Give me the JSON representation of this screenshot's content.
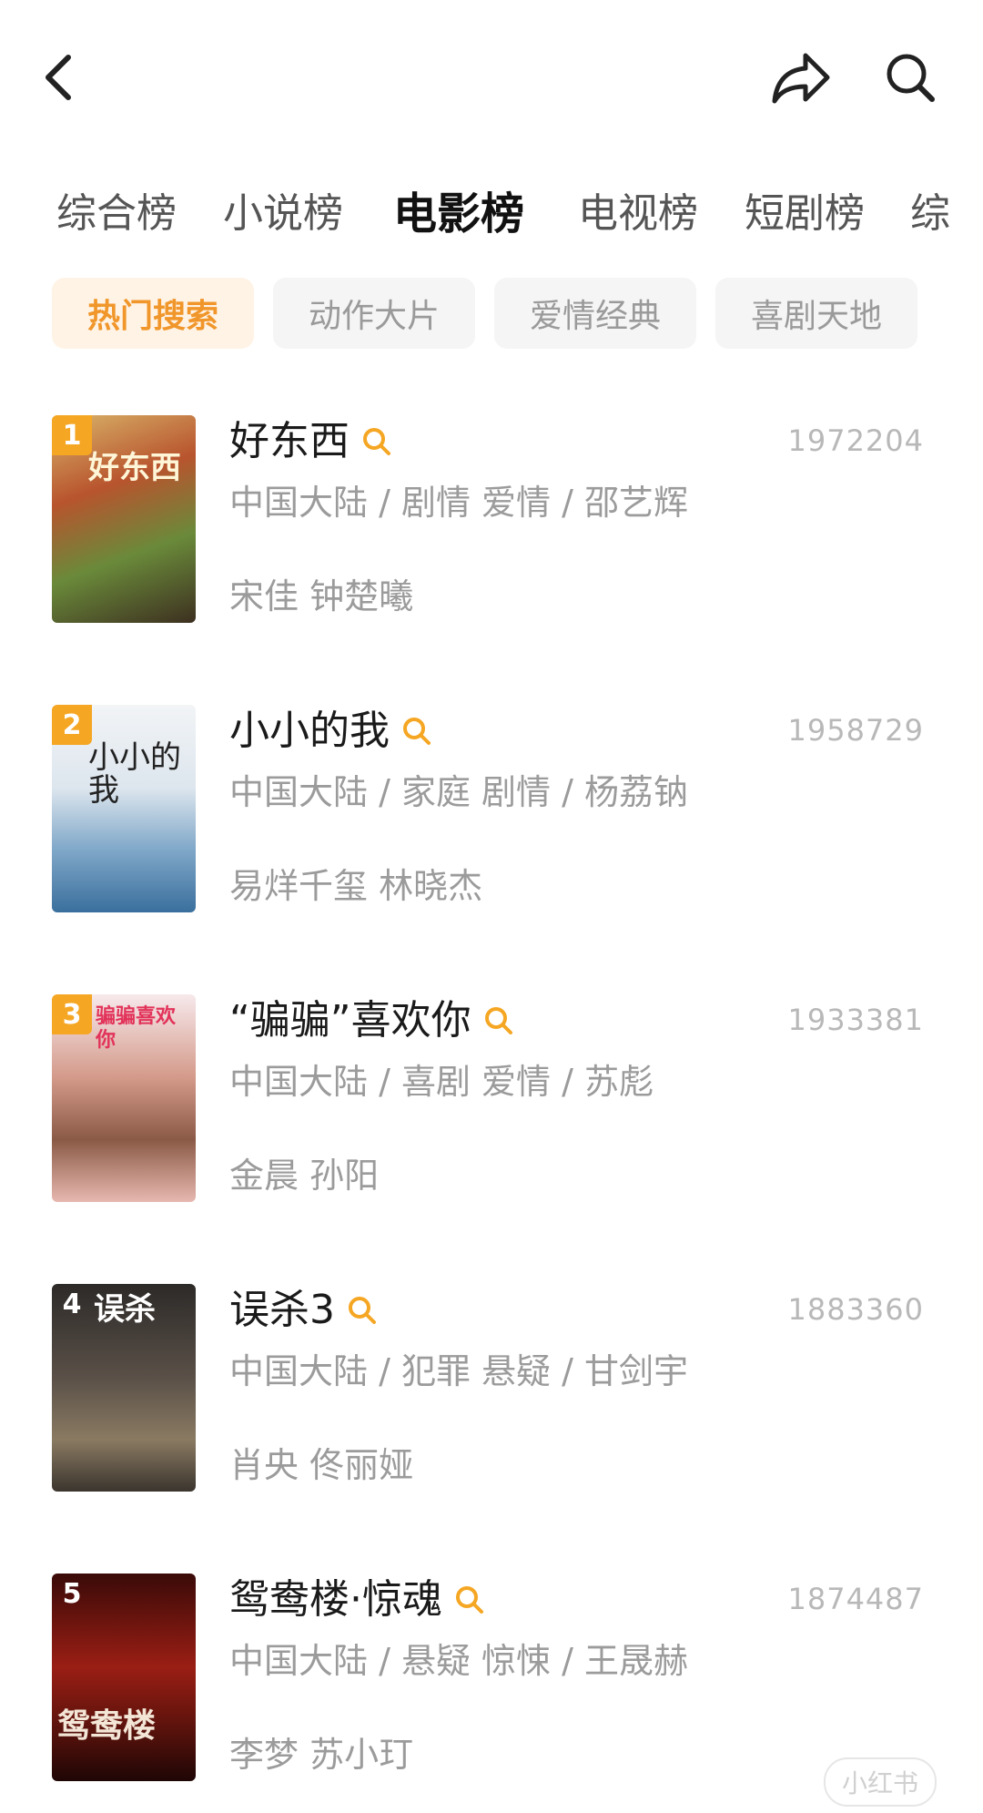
{
  "tabs": [
    "综合榜",
    "小说榜",
    "电影榜",
    "电视榜",
    "短剧榜",
    "综"
  ],
  "active_tab_index": 2,
  "chips": [
    "热门搜索",
    "动作大片",
    "爱情经典",
    "喜剧天地"
  ],
  "active_chip_index": 0,
  "icons": {
    "back": "chevron-left-icon",
    "share": "share-icon",
    "search": "search-icon"
  },
  "colors": {
    "accent": "#f5a623",
    "chip_active_bg": "#fff3e6",
    "chip_active_text": "#f0962a"
  },
  "movies": [
    {
      "rank": "1",
      "title": "好东西",
      "meta": "中国大陆 / 剧情 爱情 / 邵艺辉",
      "cast": "宋佳 钟楚曦",
      "hot": "1972204",
      "poster_text": "好东西"
    },
    {
      "rank": "2",
      "title": "小小的我",
      "meta": "中国大陆 / 家庭 剧情 / 杨荔钠",
      "cast": "易烊千玺 林晓杰",
      "hot": "1958729",
      "poster_text": "小小的我"
    },
    {
      "rank": "3",
      "title": "“骗骗”喜欢你",
      "meta": "中国大陆 / 喜剧 爱情 / 苏彪",
      "cast": "金晨 孙阳",
      "hot": "1933381",
      "poster_text": "骗骗喜欢你"
    },
    {
      "rank": "4",
      "title": "误杀3",
      "meta": "中国大陆 / 犯罪 悬疑 / 甘剑宇",
      "cast": "肖央 佟丽娅",
      "hot": "1883360",
      "poster_text": "误杀"
    },
    {
      "rank": "5",
      "title": "鸳鸯楼·惊魂",
      "meta": "中国大陆 / 悬疑 惊悚 / 王晟赫",
      "cast": "李梦 苏小玎",
      "hot": "1874487",
      "poster_text": "鸳鸯楼"
    }
  ],
  "watermark": "小红书"
}
